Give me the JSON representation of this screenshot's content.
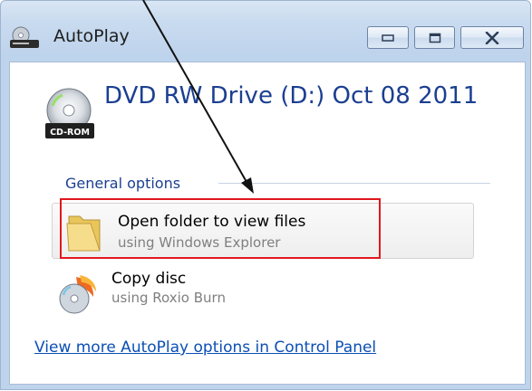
{
  "window": {
    "title": "AutoPlay",
    "icons": {
      "app": "autoplay-drive-icon",
      "minimize": "minimize-icon",
      "maximize": "maximize-icon",
      "close": "close-icon"
    }
  },
  "drive": {
    "title": "DVD RW Drive (D:) Oct 08 2011",
    "icon": "cd-rom-icon",
    "badge": "CD-ROM"
  },
  "group": {
    "label": "General options"
  },
  "options": [
    {
      "main": "Open folder to view files",
      "sub": "using Windows Explorer",
      "icon": "folder-icon"
    },
    {
      "main": "Copy disc",
      "sub": "using Roxio Burn",
      "icon": "copy-disc-icon"
    }
  ],
  "footer": {
    "link": "View more AutoPlay options in Control Panel"
  },
  "colors": {
    "accent": "#1b3f91",
    "link": "#0b4fb5",
    "highlight": "#e2171e"
  }
}
